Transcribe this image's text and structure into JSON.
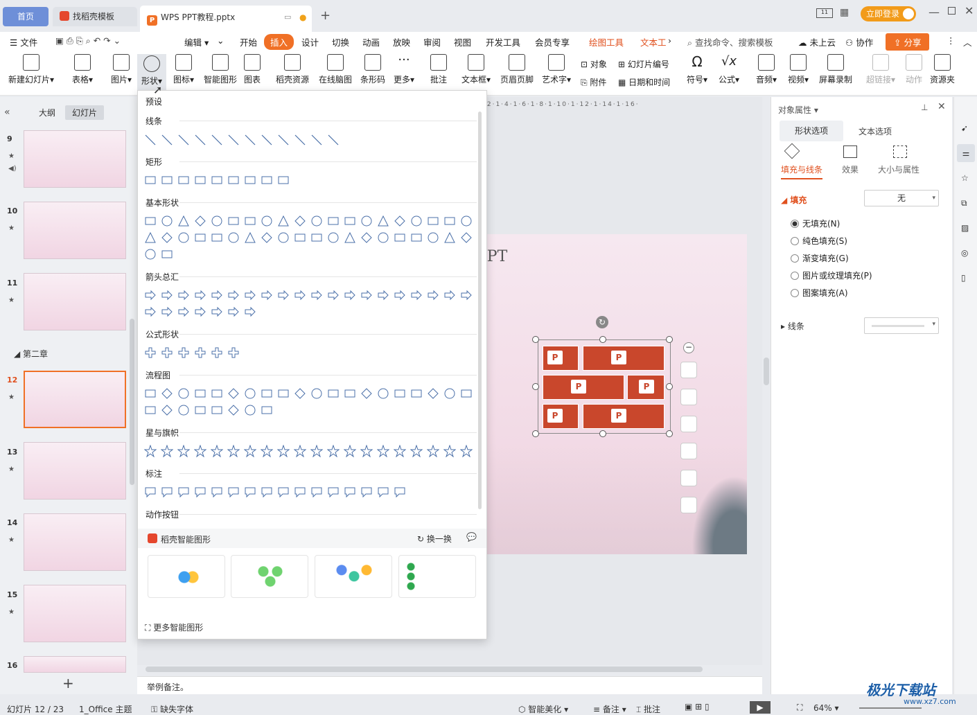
{
  "tabs": {
    "home": "首页",
    "daoke": "找稻壳模板",
    "active": "WPS PPT教程.pptx"
  },
  "titlebar": {
    "login": "立即登录"
  },
  "menu": {
    "file": "文件",
    "edit": "编辑",
    "items": [
      "开始",
      "插入",
      "设计",
      "切换",
      "动画",
      "放映",
      "审阅",
      "视图",
      "开发工具",
      "会员专享",
      "绘图工具",
      "文本工"
    ],
    "search": "查找命令、搜索模板",
    "cloud": "未上云",
    "collab": "协作",
    "share": "分享"
  },
  "ribbon": {
    "new_slide": "新建幻灯片",
    "table": "表格",
    "picture": "图片",
    "shape": "形状",
    "icon": "图标",
    "smart": "智能图形",
    "chart": "图表",
    "daoke": "稻壳资源",
    "mindmap": "在线脑图",
    "barcode": "条形码",
    "more": "更多",
    "comment": "批注",
    "textbox": "文本框",
    "header": "页眉页脚",
    "arttext": "艺术字",
    "object": "对象",
    "attach": "附件",
    "slidenum": "幻灯片编号",
    "datetime": "日期和时间",
    "symbol": "符号",
    "formula": "公式",
    "audio": "音频",
    "video": "视频",
    "record": "屏幕录制",
    "hyperlink": "超链接",
    "action": "动作",
    "resource": "资源夹"
  },
  "left": {
    "outline": "大纲",
    "slides": "幻灯片",
    "chapter": "第二章",
    "nums": [
      "9",
      "10",
      "11",
      "12",
      "13",
      "14",
      "15",
      "16"
    ],
    "add": "+"
  },
  "dropdown": {
    "preset": "预设",
    "sections": [
      "线条",
      "矩形",
      "基本形状",
      "箭头总汇",
      "公式形状",
      "流程图",
      "星与旗帜",
      "标注",
      "动作按钮"
    ],
    "smart_title": "稻壳智能图形",
    "refresh": "换一换",
    "more_smart": "更多智能图形"
  },
  "slide": {
    "title_fragment": "PPT"
  },
  "right": {
    "header": "对象属性",
    "tab_shape": "形状选项",
    "tab_text": "文本选项",
    "sub1": "填充与线条",
    "sub2": "效果",
    "sub3": "大小与属性",
    "fill": "填充",
    "fill_value": "无",
    "opts": [
      "无填充(N)",
      "纯色填充(S)",
      "渐变填充(G)",
      "图片或纹理填充(P)",
      "图案填充(A)"
    ],
    "line": "线条"
  },
  "notes": "举例备注。",
  "status": {
    "slide": "幻灯片 12 / 23",
    "theme": "1_Office 主题",
    "font": "缺失字体",
    "beautify": "智能美化",
    "notes": "备注",
    "comment": "批注",
    "zoom": "64%"
  },
  "watermark": {
    "name": "极光下载站",
    "url": "www.xz7.com"
  },
  "colors": {
    "accent": "#f07026",
    "brand_red": "#c9472c",
    "home_tab": "#6e8fd8",
    "login": "#f29b1a"
  }
}
